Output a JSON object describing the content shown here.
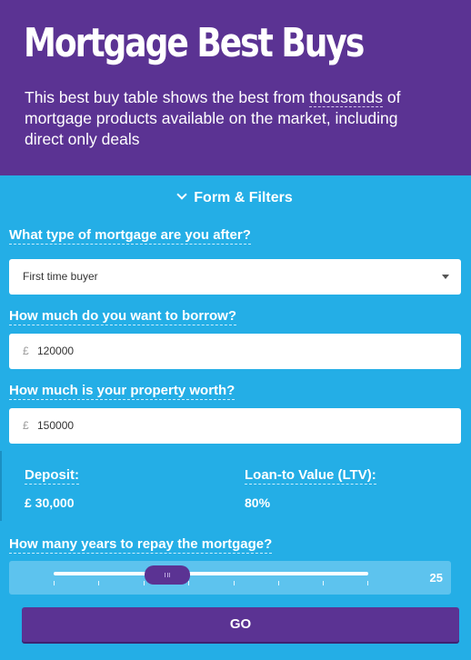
{
  "header": {
    "title": "Mortgage Best Buys",
    "intro_before": "This best buy table shows the best from ",
    "intro_link": "thousands",
    "intro_after": " of mortgage products available on the market, including direct only deals"
  },
  "filters": {
    "toggle_label": "Form & Filters",
    "mortgage_type": {
      "question": "What type of mortgage are you after?",
      "selected": "First time buyer"
    },
    "borrow": {
      "question": "How much do you want to borrow?",
      "currency": "£",
      "value": "120000"
    },
    "property": {
      "question": "How much is your property worth?",
      "currency": "£",
      "value": "150000"
    },
    "deposit": {
      "label": "Deposit:",
      "value": "£ 30,000"
    },
    "ltv": {
      "label": "Loan-to Value (LTV):",
      "value": "80%"
    },
    "term": {
      "question": "How many years to repay the mortgage?",
      "value": "25"
    },
    "go_label": "GO"
  },
  "colors": {
    "header_bg": "#5b3393",
    "panel_bg": "#24aee6",
    "button_bg": "#5b3393"
  }
}
